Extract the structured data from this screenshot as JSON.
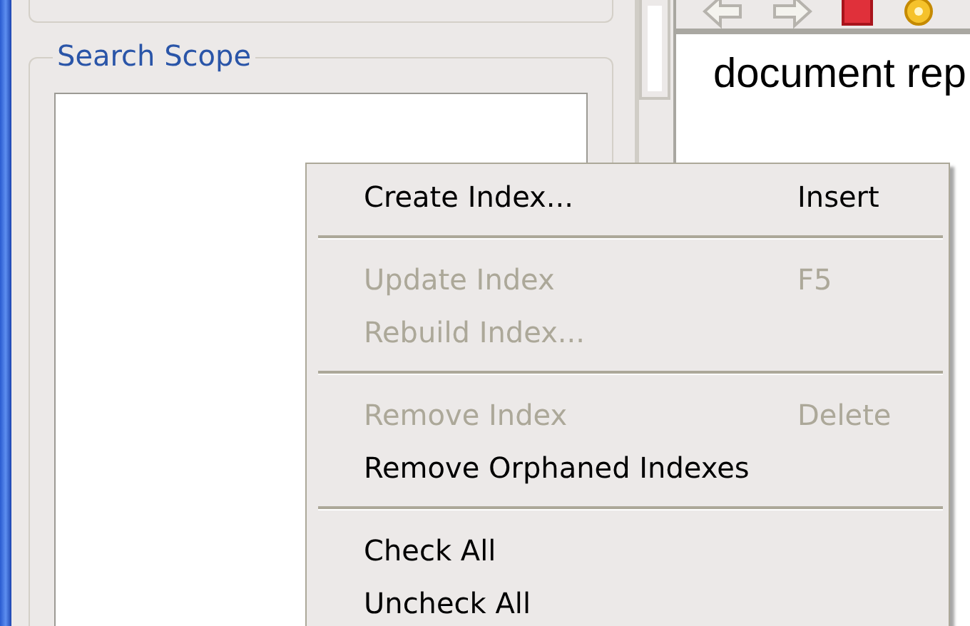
{
  "search_scope": {
    "label": "Search Scope"
  },
  "document": {
    "text": "document rep"
  },
  "context_menu": {
    "items": [
      {
        "kind": "item",
        "label": "Create Index...",
        "shortcut": "Insert",
        "disabled": false
      },
      {
        "kind": "separator"
      },
      {
        "kind": "item",
        "label": "Update Index",
        "shortcut": "F5",
        "disabled": true
      },
      {
        "kind": "item",
        "label": "Rebuild Index...",
        "disabled": true
      },
      {
        "kind": "separator"
      },
      {
        "kind": "item",
        "label": "Remove Index",
        "shortcut": "Delete",
        "disabled": true
      },
      {
        "kind": "item",
        "label": "Remove Orphaned Indexes",
        "disabled": false
      },
      {
        "kind": "separator"
      },
      {
        "kind": "item",
        "label": "Check All",
        "disabled": false
      },
      {
        "kind": "item",
        "label": "Uncheck All",
        "disabled": false
      }
    ]
  }
}
